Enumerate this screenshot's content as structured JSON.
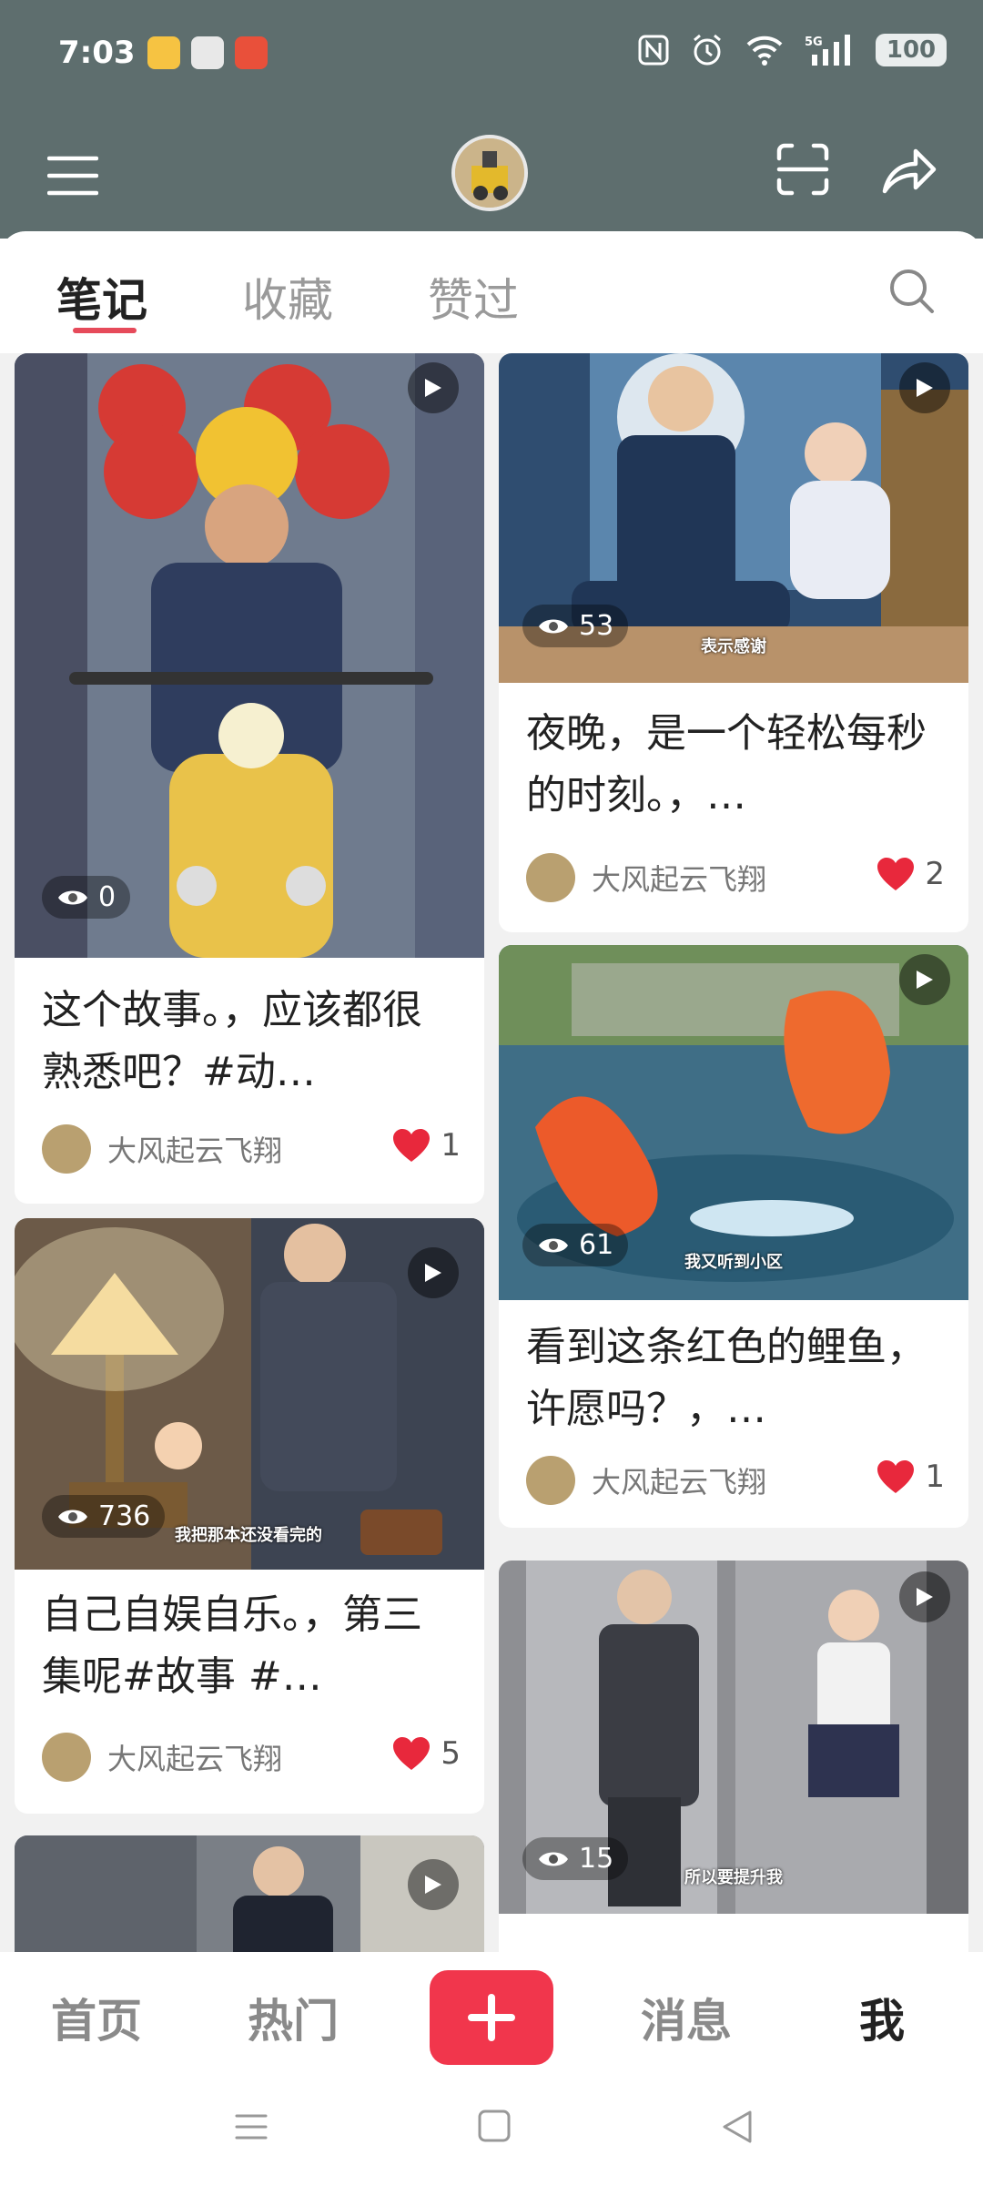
{
  "status": {
    "time": "7:03",
    "battery": "100"
  },
  "tabs": [
    {
      "label": "笔记"
    },
    {
      "label": "收藏"
    },
    {
      "label": "赞过"
    }
  ],
  "colors": {
    "header": "#5e6e6e",
    "accent": "#f1364c",
    "like": "#e8283c"
  },
  "cards": [
    {
      "views": "0",
      "title": "这个故事。，应该都很熟悉吧？#动…",
      "author": "大风起云飞翔",
      "likes": "1",
      "caption": ""
    },
    {
      "views": "53",
      "title": "夜晚，是一个轻松每秒的时刻。，…",
      "author": "大风起云飞翔",
      "likes": "2",
      "caption": "表示感谢"
    },
    {
      "views": "61",
      "title": "看到这条红色的鲤鱼，许愿吗？，…",
      "author": "大风起云飞翔",
      "likes": "1",
      "caption": "我又听到小区"
    },
    {
      "views": "736",
      "title": "自己自娱自乐。，第三集呢#故事 #…",
      "author": "大风起云飞翔",
      "likes": "5",
      "caption": "我把那本还没看完的"
    },
    {
      "views": "15",
      "title": "",
      "author": "",
      "likes": "",
      "caption": "所以要提升我"
    },
    {
      "views": "",
      "title": "",
      "author": "",
      "likes": "",
      "caption": ""
    }
  ],
  "bottom_nav": [
    {
      "label": "首页"
    },
    {
      "label": "热门"
    },
    {
      "label": "消息"
    },
    {
      "label": "我"
    }
  ]
}
